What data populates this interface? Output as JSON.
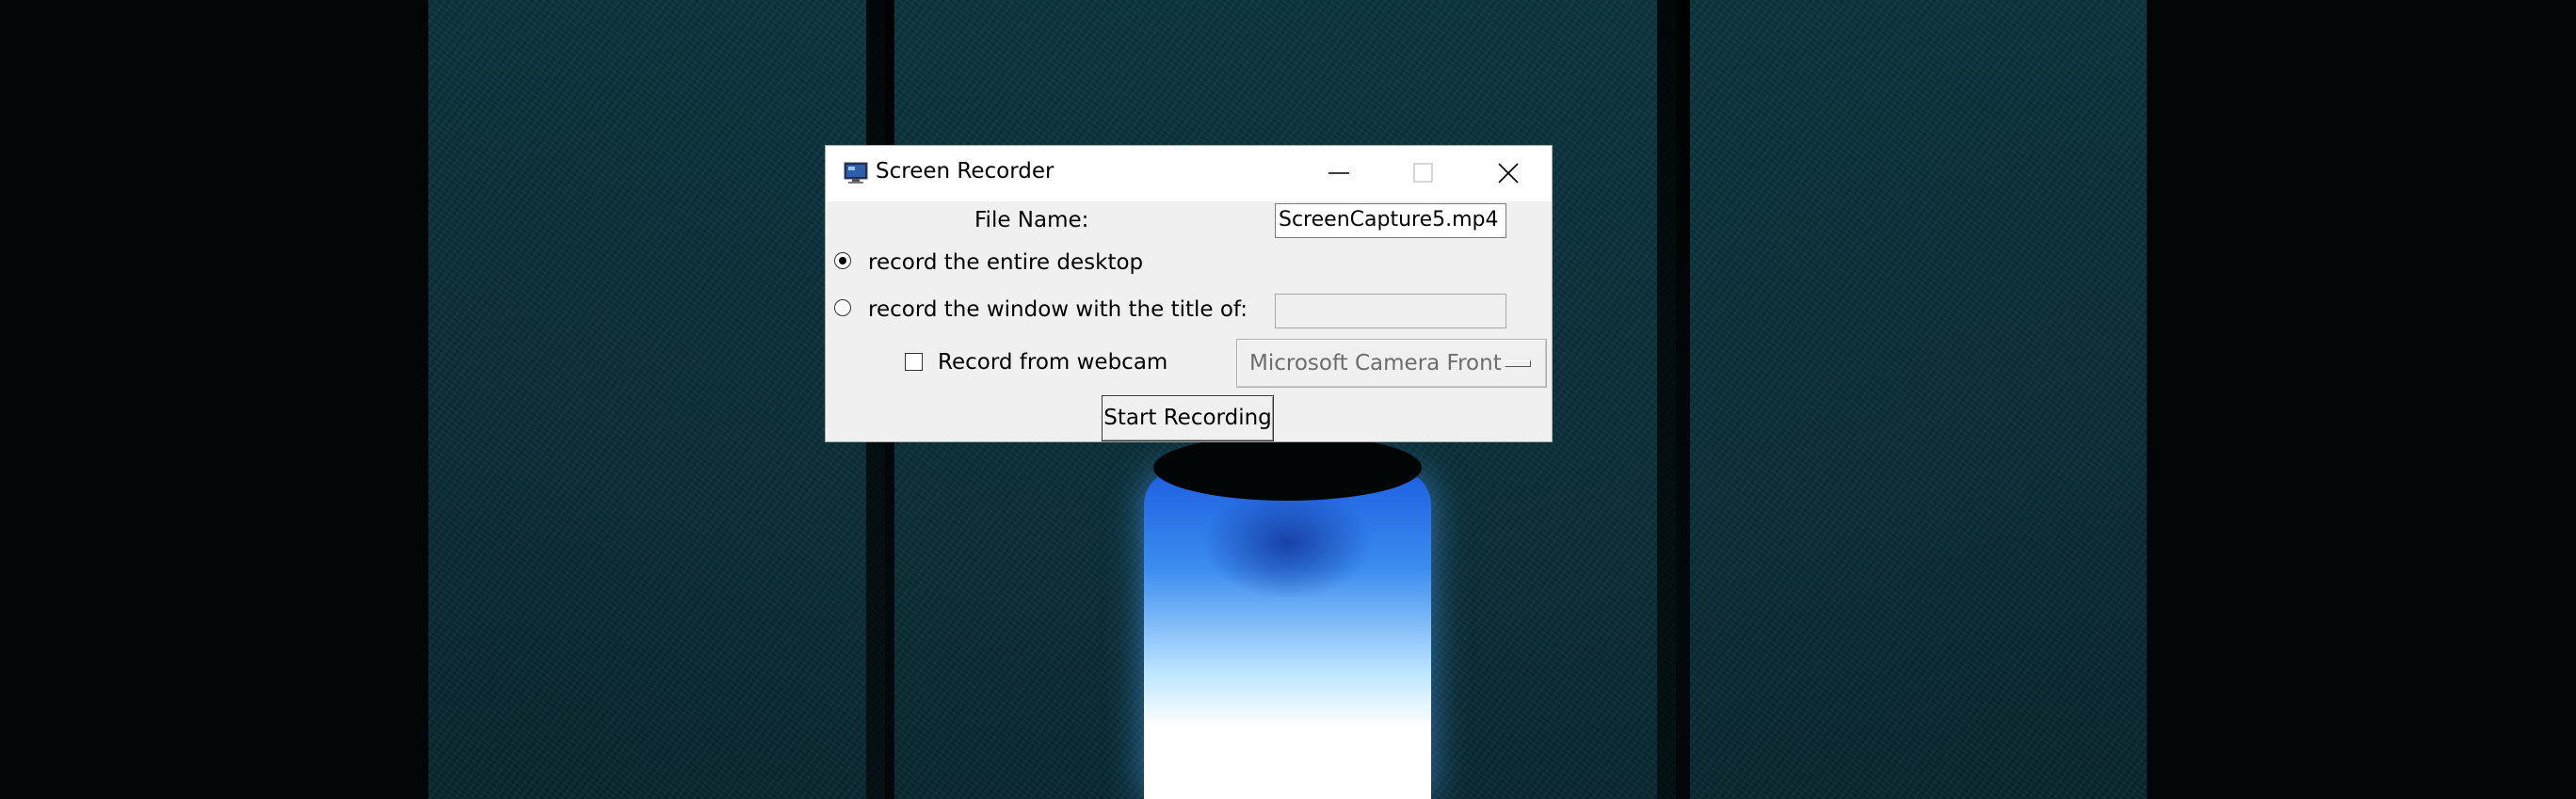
{
  "window": {
    "title": "Screen Recorder",
    "app_icon": "monitor-icon",
    "controls": {
      "minimize_icon": "minimize-icon",
      "maximize_icon": "maximize-icon",
      "close_icon": "close-icon"
    }
  },
  "form": {
    "file_name_label": "File Name:",
    "file_name_value": "ScreenCapture5.mp4",
    "record_mode": {
      "options": [
        {
          "label": "record the entire desktop",
          "selected": true
        },
        {
          "label": "record the window with the title of:",
          "selected": false
        }
      ]
    },
    "window_title_value": "",
    "webcam": {
      "label": "Record from webcam",
      "checked": false,
      "camera_selected": "Microsoft Camera Front"
    },
    "start_button_label": "Start Recording"
  },
  "colors": {
    "window_bg": "#f0f0f0",
    "titlebar_bg": "#ffffff",
    "disabled_text": "#6d6d6d"
  }
}
